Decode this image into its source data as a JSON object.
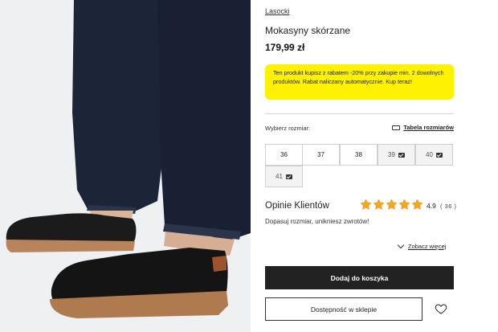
{
  "product": {
    "brand": "Lasocki",
    "title": "Mokasyny skórzane",
    "price": "179,99 zł",
    "promo": "Ten produkt kupisz z rabatem -20% przy zakupie min. 2 dowolnych produktów. Rabat naliczany automatycznie. Kup teraz!"
  },
  "sizes": {
    "label": "Wybierz rozmiar:",
    "table_link": "Tabela rozmiarów",
    "options": [
      {
        "size": "36",
        "available": true
      },
      {
        "size": "37",
        "available": true
      },
      {
        "size": "38",
        "available": true
      },
      {
        "size": "39",
        "available": false
      },
      {
        "size": "40",
        "available": false
      },
      {
        "size": "41",
        "available": false
      }
    ]
  },
  "reviews": {
    "title": "Opinie Klientów",
    "rating": "4.9",
    "count": "( 36 )",
    "stars": 5,
    "fit_note": "Dopasuj rozmiar, unikniesz zwrotów!",
    "see_more": "Zobacz więcej"
  },
  "actions": {
    "add_to_cart": "Dodaj do koszyka",
    "store_availability": "Dostępność w sklepie"
  },
  "colors": {
    "promo_bg": "#fff200",
    "star": "#f5a623",
    "button_dark": "#222222"
  },
  "icons": {
    "ruler": "ruler-icon",
    "mail": "mail-icon",
    "star": "star-icon",
    "chevron": "chevron-down-icon",
    "heart": "heart-icon"
  }
}
